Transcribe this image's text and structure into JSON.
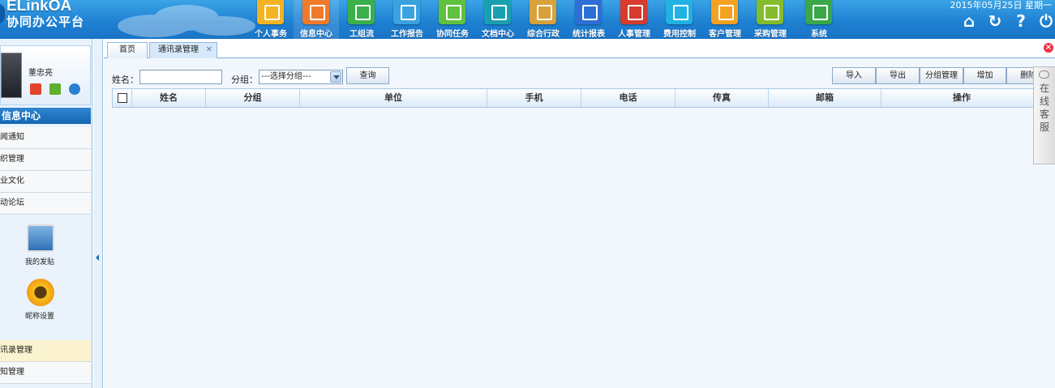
{
  "app": {
    "logo_en": "ELinkOA",
    "logo_cn": "协同办公平台"
  },
  "nav": [
    {
      "label": "个人事务",
      "color": "#f3b323"
    },
    {
      "label": "信息中心",
      "color": "#f07a2b"
    },
    {
      "label": "工组流",
      "color": "#3ab04a"
    },
    {
      "label": "工作报告",
      "color": "#3aa2e0"
    },
    {
      "label": "协同任务",
      "color": "#5fc13c"
    },
    {
      "label": "文档中心",
      "color": "#19a0b0"
    },
    {
      "label": "综合行政",
      "color": "#d9a13a"
    },
    {
      "label": "统计报表",
      "color": "#2d6fd6"
    },
    {
      "label": "人事管理",
      "color": "#d83a2e"
    },
    {
      "label": "费用控制",
      "color": "#1fb2e2"
    },
    {
      "label": "客户管理",
      "color": "#f4a21f"
    },
    {
      "label": "采购管理",
      "color": "#83bd2c"
    },
    {
      "label": "系统",
      "color": "#3aa84a"
    }
  ],
  "header": {
    "date": "2015年05月25日 星期一",
    "tool_icons": [
      "home-icon",
      "refresh-icon",
      "help-icon",
      "power-icon"
    ]
  },
  "user": {
    "name": "董忠亮"
  },
  "sidebar": {
    "module_title": "信息中心",
    "items": [
      "闻通知",
      "织管理",
      "业文化",
      "动论坛"
    ],
    "quick": [
      {
        "label": "我的发贴",
        "icon": "posting-icon"
      },
      {
        "label": "昵称设置",
        "icon": "sunflower-icon"
      }
    ],
    "bottom_items": [
      "讯录管理",
      "知管理"
    ]
  },
  "tabs": [
    {
      "label": "首页"
    },
    {
      "label": "通讯录管理"
    }
  ],
  "filter": {
    "name_label": "姓名：",
    "name_value": "",
    "group_label": "分组：",
    "group_selected": "---选择分组---",
    "query_button": "查询"
  },
  "toolbar": {
    "import": "导入",
    "export": "导出",
    "group_manage": "分组管理",
    "add": "增加",
    "delete": "删除"
  },
  "table": {
    "columns": [
      "姓名",
      "分组",
      "单位",
      "手机",
      "电话",
      "传真",
      "邮箱",
      "操作"
    ]
  },
  "service": {
    "label": "在线客服"
  }
}
